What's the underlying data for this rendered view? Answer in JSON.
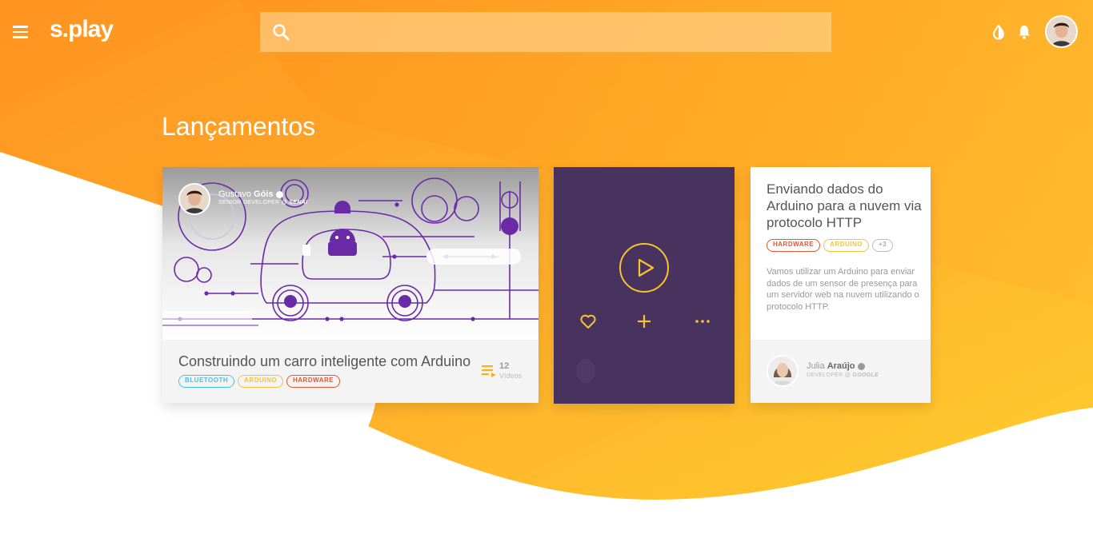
{
  "app": {
    "logo_text": "s.play"
  },
  "header": {
    "search_placeholder": "",
    "icons": [
      "menu-icon",
      "search-icon",
      "contrast-icon",
      "bell-icon",
      "user-avatar"
    ]
  },
  "section": {
    "title": "Lançamentos"
  },
  "cards": [
    {
      "title": "Construindo um carro inteligente com Arduino",
      "tags": [
        "BLUETOOTH",
        "ARDUINO",
        "HARDWARE"
      ],
      "video_count": "12",
      "video_label": "Vídeos",
      "author_first": "Gustavo",
      "author_last": "Góis",
      "author_role": "SENIOR DEVELOPER @",
      "author_org": "SENAI"
    },
    {
      "actions": [
        "play-icon",
        "heart-icon",
        "add-icon",
        "more-icon"
      ]
    },
    {
      "title": "Enviando dados do Arduino para a nuvem via protocolo HTTP",
      "tags": [
        "HARDWARE",
        "ARDUINO",
        "+3"
      ],
      "description": "Vamos utilizar um Arduino para enviar dados de um sensor de presença para um servidor web na nuvem utilizando o protocolo HTTP.",
      "author_first": "Julia",
      "author_last": "Araújo",
      "author_role": "DEVELOPER @",
      "author_org": "GOOGLE"
    }
  ],
  "colors": {
    "orange": "#ff9a1f",
    "yellow": "#ffc42e",
    "purple": "#48335f",
    "accent_purple": "#6a2aa8"
  }
}
